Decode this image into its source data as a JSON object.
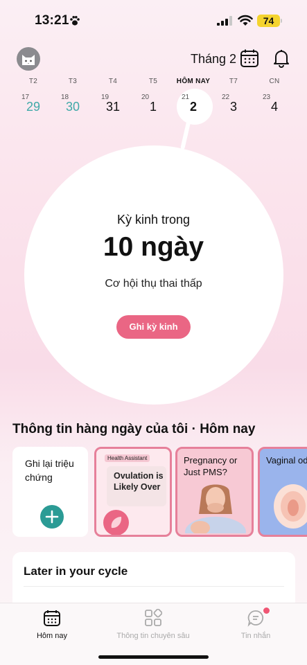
{
  "status_bar": {
    "time": "13:21",
    "battery": "74"
  },
  "header": {
    "month": "Tháng 2"
  },
  "week": [
    {
      "name": "T2",
      "small": "17",
      "big": "29",
      "style": "teal"
    },
    {
      "name": "T3",
      "small": "18",
      "big": "30",
      "style": "teal"
    },
    {
      "name": "T4",
      "small": "19",
      "big": "31",
      "style": ""
    },
    {
      "name": "T5",
      "small": "20",
      "big": "1",
      "style": ""
    },
    {
      "name": "HÔM NAY",
      "small": "21",
      "big": "2",
      "style": "today"
    },
    {
      "name": "T7",
      "small": "22",
      "big": "3",
      "style": ""
    },
    {
      "name": "CN",
      "small": "23",
      "big": "4",
      "style": ""
    }
  ],
  "cycle": {
    "label": "Kỳ kinh trong",
    "days": "10 ngày",
    "fertility": "Cơ hội thụ thai thấp",
    "button": "Ghi kỳ kinh"
  },
  "daily": {
    "title": "Thông tin hàng ngày của tôi · Hôm nay",
    "cards": {
      "log": "Ghi lại triệu chứng",
      "ovulation_badge": "Health Assistant",
      "ovulation": "Ovulation is Likely Over",
      "pms": "Pregnancy or Just PMS?",
      "vaginal": "Vaginal od guide"
    }
  },
  "later": {
    "title": "Later in your cycle"
  },
  "nav": {
    "today": "Hôm nay",
    "insights": "Thông tin chuyên sâu",
    "messages": "Tin nhắn"
  },
  "colors": {
    "accent": "#ea6684",
    "teal": "#2b9b95",
    "cycle_day_teal": "#3fa9a8"
  }
}
